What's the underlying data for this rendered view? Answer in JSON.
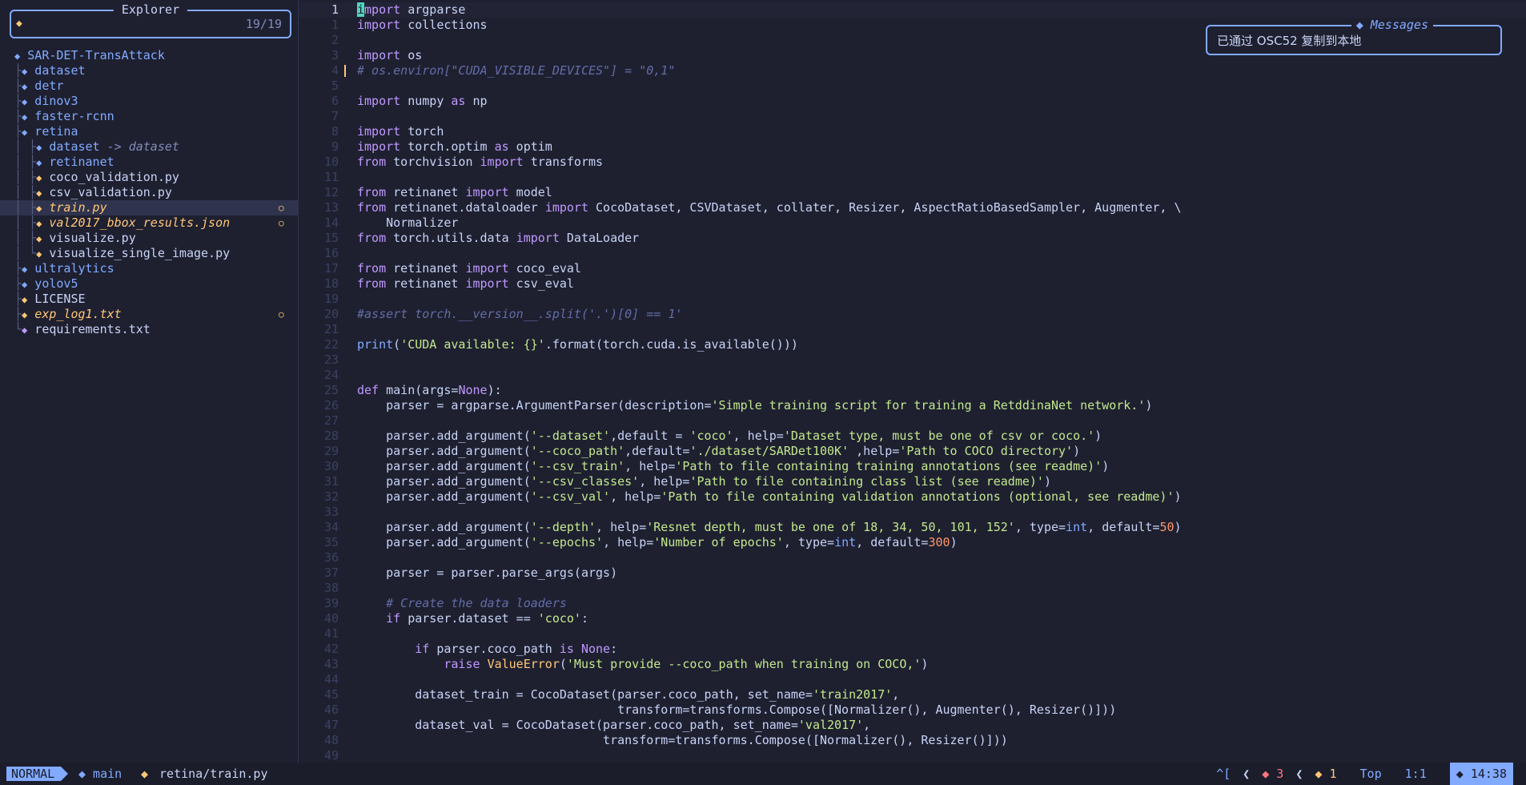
{
  "explorer": {
    "title": "Explorer",
    "prompt": "◆",
    "count": "19/19",
    "items": [
      {
        "depth": 0,
        "guide": "",
        "kind": "dir",
        "name": "SAR-DET-TransAttack",
        "mod": false
      },
      {
        "depth": 1,
        "guide": "├",
        "kind": "dir",
        "name": "dataset",
        "mod": false
      },
      {
        "depth": 1,
        "guide": "├",
        "kind": "dir",
        "name": "detr",
        "mod": false
      },
      {
        "depth": 1,
        "guide": "├",
        "kind": "dir",
        "name": "dinov3",
        "mod": false
      },
      {
        "depth": 1,
        "guide": "├",
        "kind": "dir",
        "name": "faster-rcnn",
        "mod": false
      },
      {
        "depth": 1,
        "guide": "├",
        "kind": "dir",
        "name": "retina",
        "mod": false
      },
      {
        "depth": 2,
        "guide": "│ ├",
        "kind": "dir",
        "name": "dataset",
        "link": "-> dataset",
        "mod": false
      },
      {
        "depth": 2,
        "guide": "│ ├",
        "kind": "dir",
        "name": "retinanet",
        "mod": false
      },
      {
        "depth": 2,
        "guide": "│ ├",
        "kind": "file",
        "name": "coco_validation.py",
        "mod": false
      },
      {
        "depth": 2,
        "guide": "│ ├",
        "kind": "file",
        "name": "csv_validation.py",
        "mod": false
      },
      {
        "depth": 2,
        "guide": "│ ├",
        "kind": "file",
        "name": "train.py",
        "mod": true,
        "sel": true
      },
      {
        "depth": 2,
        "guide": "│ ├",
        "kind": "file",
        "name": "val2017_bbox_results.json",
        "mod": true
      },
      {
        "depth": 2,
        "guide": "│ ├",
        "kind": "file",
        "name": "visualize.py",
        "mod": false
      },
      {
        "depth": 2,
        "guide": "│ └",
        "kind": "file",
        "name": "visualize_single_image.py",
        "mod": false
      },
      {
        "depth": 1,
        "guide": "├",
        "kind": "dir",
        "name": "ultralytics",
        "mod": false
      },
      {
        "depth": 1,
        "guide": "├",
        "kind": "dir",
        "name": "yolov5",
        "mod": false
      },
      {
        "depth": 1,
        "guide": "├",
        "kind": "file",
        "name": "LICENSE",
        "mod": false
      },
      {
        "depth": 1,
        "guide": "├",
        "kind": "file",
        "name": "exp_log1.txt",
        "mod": true
      },
      {
        "depth": 1,
        "guide": "└",
        "kind": "purple",
        "name": "requirements.txt",
        "mod": false
      }
    ],
    "mod_icon": "○"
  },
  "editor": {
    "lines": [
      {
        "n": "1",
        "code": "import argparse"
      },
      {
        "n": "1",
        "code": "import collections"
      },
      {
        "n": "2",
        "code": ""
      },
      {
        "n": "3",
        "code": "import os"
      },
      {
        "n": "4",
        "code": "# os.environ[\"CUDA_VISIBLE_DEVICES\"] = \"0,1\""
      },
      {
        "n": "5",
        "code": ""
      },
      {
        "n": "6",
        "code": "import numpy as np"
      },
      {
        "n": "7",
        "code": ""
      },
      {
        "n": "8",
        "code": "import torch"
      },
      {
        "n": "9",
        "code": "import torch.optim as optim"
      },
      {
        "n": "10",
        "code": "from torchvision import transforms"
      },
      {
        "n": "11",
        "code": ""
      },
      {
        "n": "12",
        "code": "from retinanet import model"
      },
      {
        "n": "13",
        "code": "from retinanet.dataloader import CocoDataset, CSVDataset, collater, Resizer, AspectRatioBasedSampler, Augmenter, \\"
      },
      {
        "n": "14",
        "code": "    Normalizer"
      },
      {
        "n": "15",
        "code": "from torch.utils.data import DataLoader"
      },
      {
        "n": "16",
        "code": ""
      },
      {
        "n": "17",
        "code": "from retinanet import coco_eval"
      },
      {
        "n": "18",
        "code": "from retinanet import csv_eval"
      },
      {
        "n": "19",
        "code": ""
      },
      {
        "n": "20",
        "code": "#assert torch.__version__.split('.')[0] == 1'"
      },
      {
        "n": "21",
        "code": ""
      },
      {
        "n": "22",
        "code": "print('CUDA available: {}'.format(torch.cuda.is_available()))"
      },
      {
        "n": "23",
        "code": ""
      },
      {
        "n": "24",
        "code": ""
      },
      {
        "n": "25",
        "code": "def main(args=None):"
      },
      {
        "n": "26",
        "code": "    parser = argparse.ArgumentParser(description='Simple training script for training a RetddinaNet network.')"
      },
      {
        "n": "27",
        "code": ""
      },
      {
        "n": "28",
        "code": "    parser.add_argument('--dataset',default = 'coco', help='Dataset type, must be one of csv or coco.')"
      },
      {
        "n": "29",
        "code": "    parser.add_argument('--coco_path',default='./dataset/SARDet100K' ,help='Path to COCO directory')"
      },
      {
        "n": "30",
        "code": "    parser.add_argument('--csv_train', help='Path to file containing training annotations (see readme)')"
      },
      {
        "n": "31",
        "code": "    parser.add_argument('--csv_classes', help='Path to file containing class list (see readme)')"
      },
      {
        "n": "32",
        "code": "    parser.add_argument('--csv_val', help='Path to file containing validation annotations (optional, see readme)')"
      },
      {
        "n": "33",
        "code": ""
      },
      {
        "n": "34",
        "code": "    parser.add_argument('--depth', help='Resnet depth, must be one of 18, 34, 50, 101, 152', type=int, default=50)"
      },
      {
        "n": "35",
        "code": "    parser.add_argument('--epochs', help='Number of epochs', type=int, default=300)"
      },
      {
        "n": "36",
        "code": ""
      },
      {
        "n": "37",
        "code": "    parser = parser.parse_args(args)"
      },
      {
        "n": "38",
        "code": ""
      },
      {
        "n": "39",
        "code": "    # Create the data loaders"
      },
      {
        "n": "40",
        "code": "    if parser.dataset == 'coco':"
      },
      {
        "n": "41",
        "code": ""
      },
      {
        "n": "42",
        "code": "        if parser.coco_path is None:"
      },
      {
        "n": "43",
        "code": "            raise ValueError('Must provide --coco_path when training on COCO,')"
      },
      {
        "n": "44",
        "code": ""
      },
      {
        "n": "45",
        "code": "        dataset_train = CocoDataset(parser.coco_path, set_name='train2017',"
      },
      {
        "n": "46",
        "code": "                                    transform=transforms.Compose([Normalizer(), Augmenter(), Resizer()]))"
      },
      {
        "n": "47",
        "code": "        dataset_val = CocoDataset(parser.coco_path, set_name='val2017',"
      },
      {
        "n": "48",
        "code": "                                  transform=transforms.Compose([Normalizer(), Resizer()]))"
      },
      {
        "n": "49",
        "code": ""
      }
    ]
  },
  "messages": {
    "title": "◆  Messages",
    "text": "已通过 OSC52 复制到本地"
  },
  "statusline": {
    "mode": "NORMAL",
    "branch": "◆ main",
    "file_icon": "◆",
    "file_path": "retina/train.py",
    "bracket": "^[",
    "errors": "◆ 3",
    "warnings": "◆ 1",
    "position_label": "Top",
    "cursor_pos": "1:1",
    "clock": "◆ 14:38"
  },
  "colors": {
    "background": "#1e2030",
    "accent": "#82aaff",
    "keyword": "#c099ff",
    "string": "#c3e88d",
    "number": "#ff966c",
    "comment": "#636da6",
    "modified": "#ffc777"
  }
}
